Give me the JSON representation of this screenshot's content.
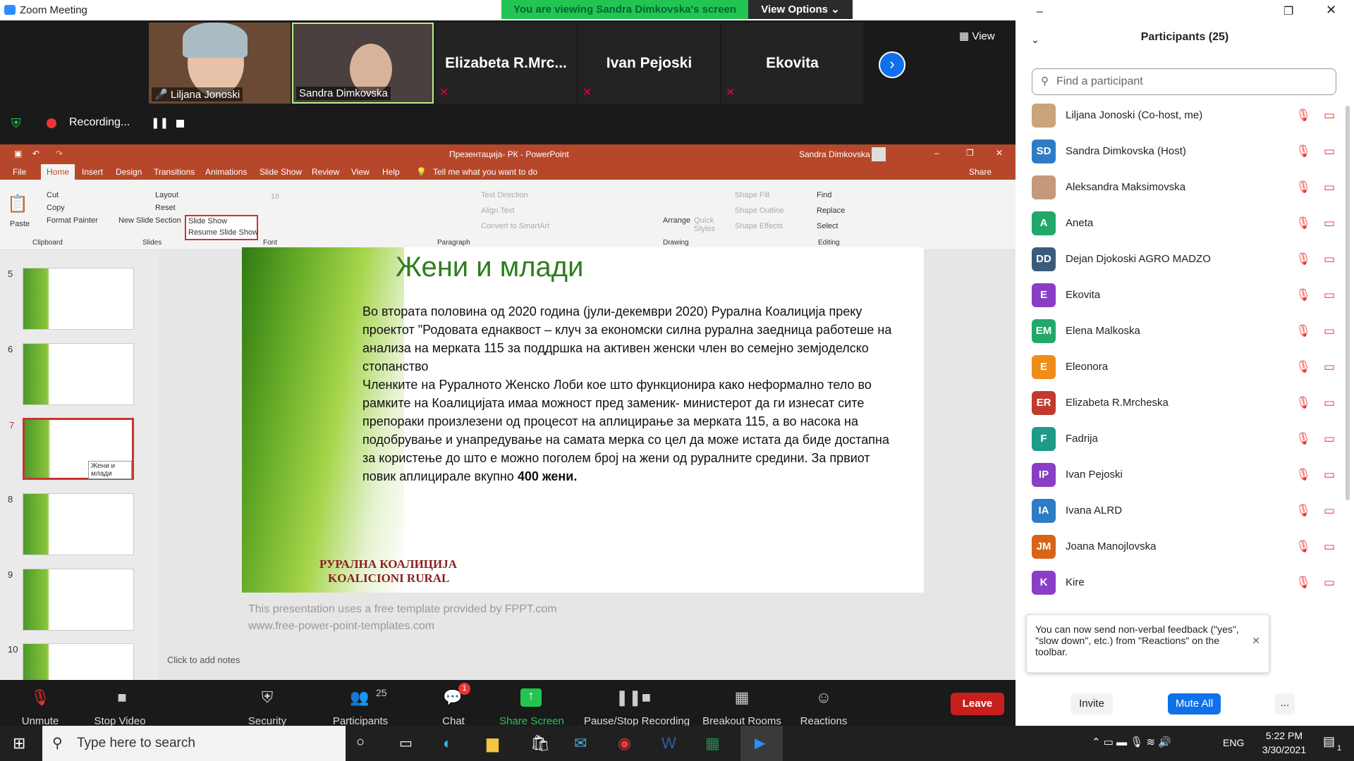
{
  "window": {
    "title": "Zoom Meeting",
    "viewing_banner": "You are viewing Sandra Dimkovska's screen",
    "view_options": "View Options",
    "view_btn": "View"
  },
  "video_tiles": [
    {
      "name": "Liljana Jonoski"
    },
    {
      "name": "Sandra Dimkovska"
    },
    {
      "name": "Elizabeta  R.Mrc..."
    },
    {
      "name": "Ivan Pejoski"
    },
    {
      "name": "Ekovita"
    }
  ],
  "recording": {
    "label": "Recording..."
  },
  "ppt": {
    "title": "Презентација- РК  -  PowerPoint",
    "user": "Sandra Dimkovska",
    "tabs": [
      "File",
      "Home",
      "Insert",
      "Design",
      "Transitions",
      "Animations",
      "Slide Show",
      "Review",
      "View",
      "Help",
      "Tell me what you want to do",
      "Share"
    ],
    "ribbon": {
      "cut": "Cut",
      "copy": "Copy",
      "paste": "Paste",
      "format_painter": "Format Painter",
      "clipboard": "Clipboard",
      "new_slide": "New Slide",
      "layout": "Layout",
      "reset": "Reset",
      "section": "Section",
      "slides": "Slides",
      "slideshow": "Slide Show",
      "resume": "Resume Slide Show",
      "font": "Font",
      "font_size": "16",
      "text_direction": "Text Direction",
      "align_text": "Align Text",
      "convert": "Convert to SmartArt",
      "paragraph": "Paragraph",
      "arrange": "Arrange",
      "quick_styles": "Quick Styles",
      "shape_fill": "Shape Fill",
      "shape_outline": "Shape Outline",
      "shape_effects": "Shape Effects",
      "drawing": "Drawing",
      "find": "Find",
      "replace": "Replace",
      "select": "Select",
      "editing": "Editing"
    },
    "thumb_numbers": [
      "5",
      "6",
      "7",
      "8",
      "9",
      "10"
    ],
    "thumb_tooltip": "Жени и млади",
    "slide": {
      "title": "Жени и млади",
      "p1": "Во втората половина од 2020 година (јули-декември 2020) Рурална Коалиција преку проектот \"Родовата еднаквост – клуч за економски силна рурална заедница работеше на анализа на мерката 115 за поддршка на активен женски член во семејно земјоделско стопанство",
      "p2": "Членките на Руралното Женско Лоби кое што функционира како неформално тело во рамките на Коалицијата имаа можност пред заменик- министерот да ги изнесат сите препораки произлезени од процесот на аплицирање за мерката 115, а во насока на подобрување и унапредување на самата мерка со цел да може истата да биде достапна за користење до што е можно поголем број на жени од руралните средини. За првиот повик аплицирале вкупно ",
      "p2_bold": "400 жени.",
      "logo1": "РУРАЛНА КОАЛИЦИЈА",
      "logo2": "KOALICIONI RURAL"
    },
    "fppt1": "This presentation uses a free template provided by FPPT.com",
    "fppt2": "www.free-power-point-templates.com",
    "notes": "Click to add notes"
  },
  "toolbar": {
    "unmute": "Unmute",
    "stop_video": "Stop Video",
    "security": "Security",
    "participants": "Participants",
    "participants_count": "25",
    "chat": "Chat",
    "chat_badge": "1",
    "share": "Share Screen",
    "pause_rec": "Pause/Stop Recording",
    "breakout": "Breakout Rooms",
    "reactions": "Reactions",
    "leave": "Leave"
  },
  "participants": {
    "header": "Participants (25)",
    "search_placeholder": "Find a participant",
    "list": [
      {
        "initials": "",
        "name": "Liljana Jonoski (Co-host, me)",
        "color": "#c9a37a"
      },
      {
        "initials": "SD",
        "name": "Sandra Dimkovska (Host)",
        "color": "#2e7cc6"
      },
      {
        "initials": "",
        "name": "Aleksandra Maksimovska",
        "color": "#c49a7a"
      },
      {
        "initials": "A",
        "name": "Aneta",
        "color": "#22a86a"
      },
      {
        "initials": "DD",
        "name": "Dejan Djokoski AGRO MADZO",
        "color": "#3b5b7d"
      },
      {
        "initials": "E",
        "name": "Ekovita",
        "color": "#8a3ec6"
      },
      {
        "initials": "EM",
        "name": "Elena Malkoska",
        "color": "#22a86a"
      },
      {
        "initials": "E",
        "name": "Eleonora",
        "color": "#f08c1a"
      },
      {
        "initials": "ER",
        "name": "Elizabeta R.Mrcheska",
        "color": "#c23a2e"
      },
      {
        "initials": "F",
        "name": "Fadrija",
        "color": "#1e9a8a"
      },
      {
        "initials": "IP",
        "name": "Ivan Pejoski",
        "color": "#8a3ec6"
      },
      {
        "initials": "IA",
        "name": "Ivana ALRD",
        "color": "#2e7cc6"
      },
      {
        "initials": "JM",
        "name": "Joana Manojlovska",
        "color": "#d8641a"
      },
      {
        "initials": "K",
        "name": "Kire",
        "color": "#8a3ec6"
      }
    ],
    "tip": "You can now send non-verbal feedback (\"yes\", \"slow down\", etc.) from \"Reactions\" on the toolbar.",
    "invite": "Invite",
    "mute_all": "Mute All",
    "more": "..."
  },
  "taskbar": {
    "search": "Type here to search",
    "time": "5:22 PM",
    "date": "3/30/2021",
    "lang": "ENG",
    "notif": "1"
  }
}
